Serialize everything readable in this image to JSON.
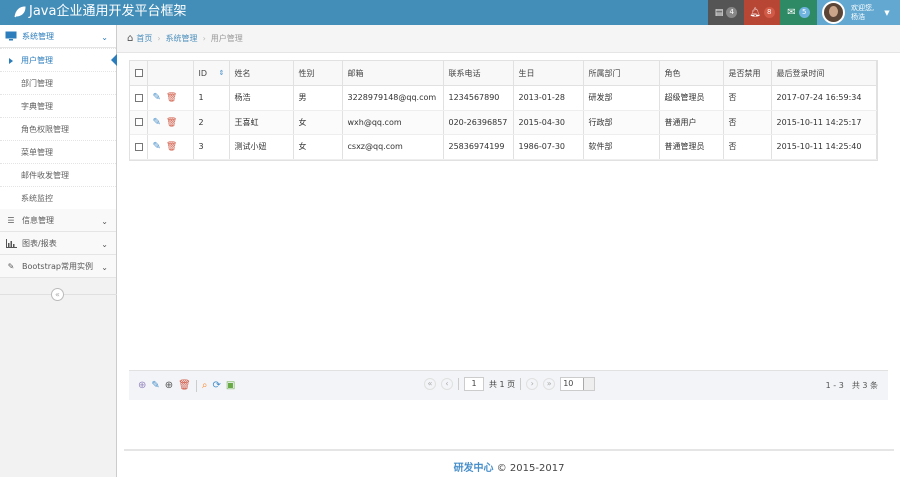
{
  "app": {
    "title": "Java企业通用开发平台框架"
  },
  "topbar": {
    "tasks_count": "4",
    "notify_count": "8",
    "messages_count": "5",
    "user_greeting": "欢迎您,",
    "user_name": "杨浩",
    "colors": {
      "bar": "#438eb9",
      "tasks": "#555555",
      "notify": "#b74635",
      "messages": "#2e8965",
      "user": "#62a8d1"
    }
  },
  "sidebar": {
    "menus": [
      {
        "label": "系统管理",
        "icon": "monitor-icon",
        "open": true
      },
      {
        "label": "信息管理",
        "icon": "list-icon"
      },
      {
        "label": "图表/报表",
        "icon": "bar-chart-icon"
      },
      {
        "label": "Bootstrap常用实例",
        "icon": "edit-icon"
      }
    ],
    "system_items": [
      "用户管理",
      "部门管理",
      "字典管理",
      "角色权限管理",
      "菜单管理",
      "邮件收发管理",
      "系统监控"
    ]
  },
  "breadcrumb": {
    "home": "首页",
    "section": "系统管理",
    "current": "用户管理"
  },
  "table": {
    "headers": [
      "ID",
      "姓名",
      "性别",
      "邮箱",
      "联系电话",
      "生日",
      "所属部门",
      "角色",
      "是否禁用",
      "最后登录时间"
    ],
    "rows": [
      [
        "1",
        "杨浩",
        "男",
        "3228979148@qq.com",
        "1234567890",
        "2013-01-28",
        "研发部",
        "超级管理员",
        "否",
        "2017-07-24 16:59:34"
      ],
      [
        "2",
        "王喜虹",
        "女",
        "wxh@qq.com",
        "020-26396857",
        "2015-04-30",
        "行政部",
        "普通用户",
        "否",
        "2015-10-11 14:25:17"
      ],
      [
        "3",
        "测试小妞",
        "女",
        "csxz@qq.com",
        "25836974199",
        "1986-07-30",
        "软件部",
        "普通管理员",
        "否",
        "2015-10-11 14:25:40"
      ]
    ]
  },
  "pager": {
    "page": "1",
    "total_pages_label": "共 1 页",
    "page_size": "10",
    "info": "1 - 3　共 3 条"
  },
  "footer": {
    "org": "研发中心",
    "copyright": "© 2015-2017"
  }
}
